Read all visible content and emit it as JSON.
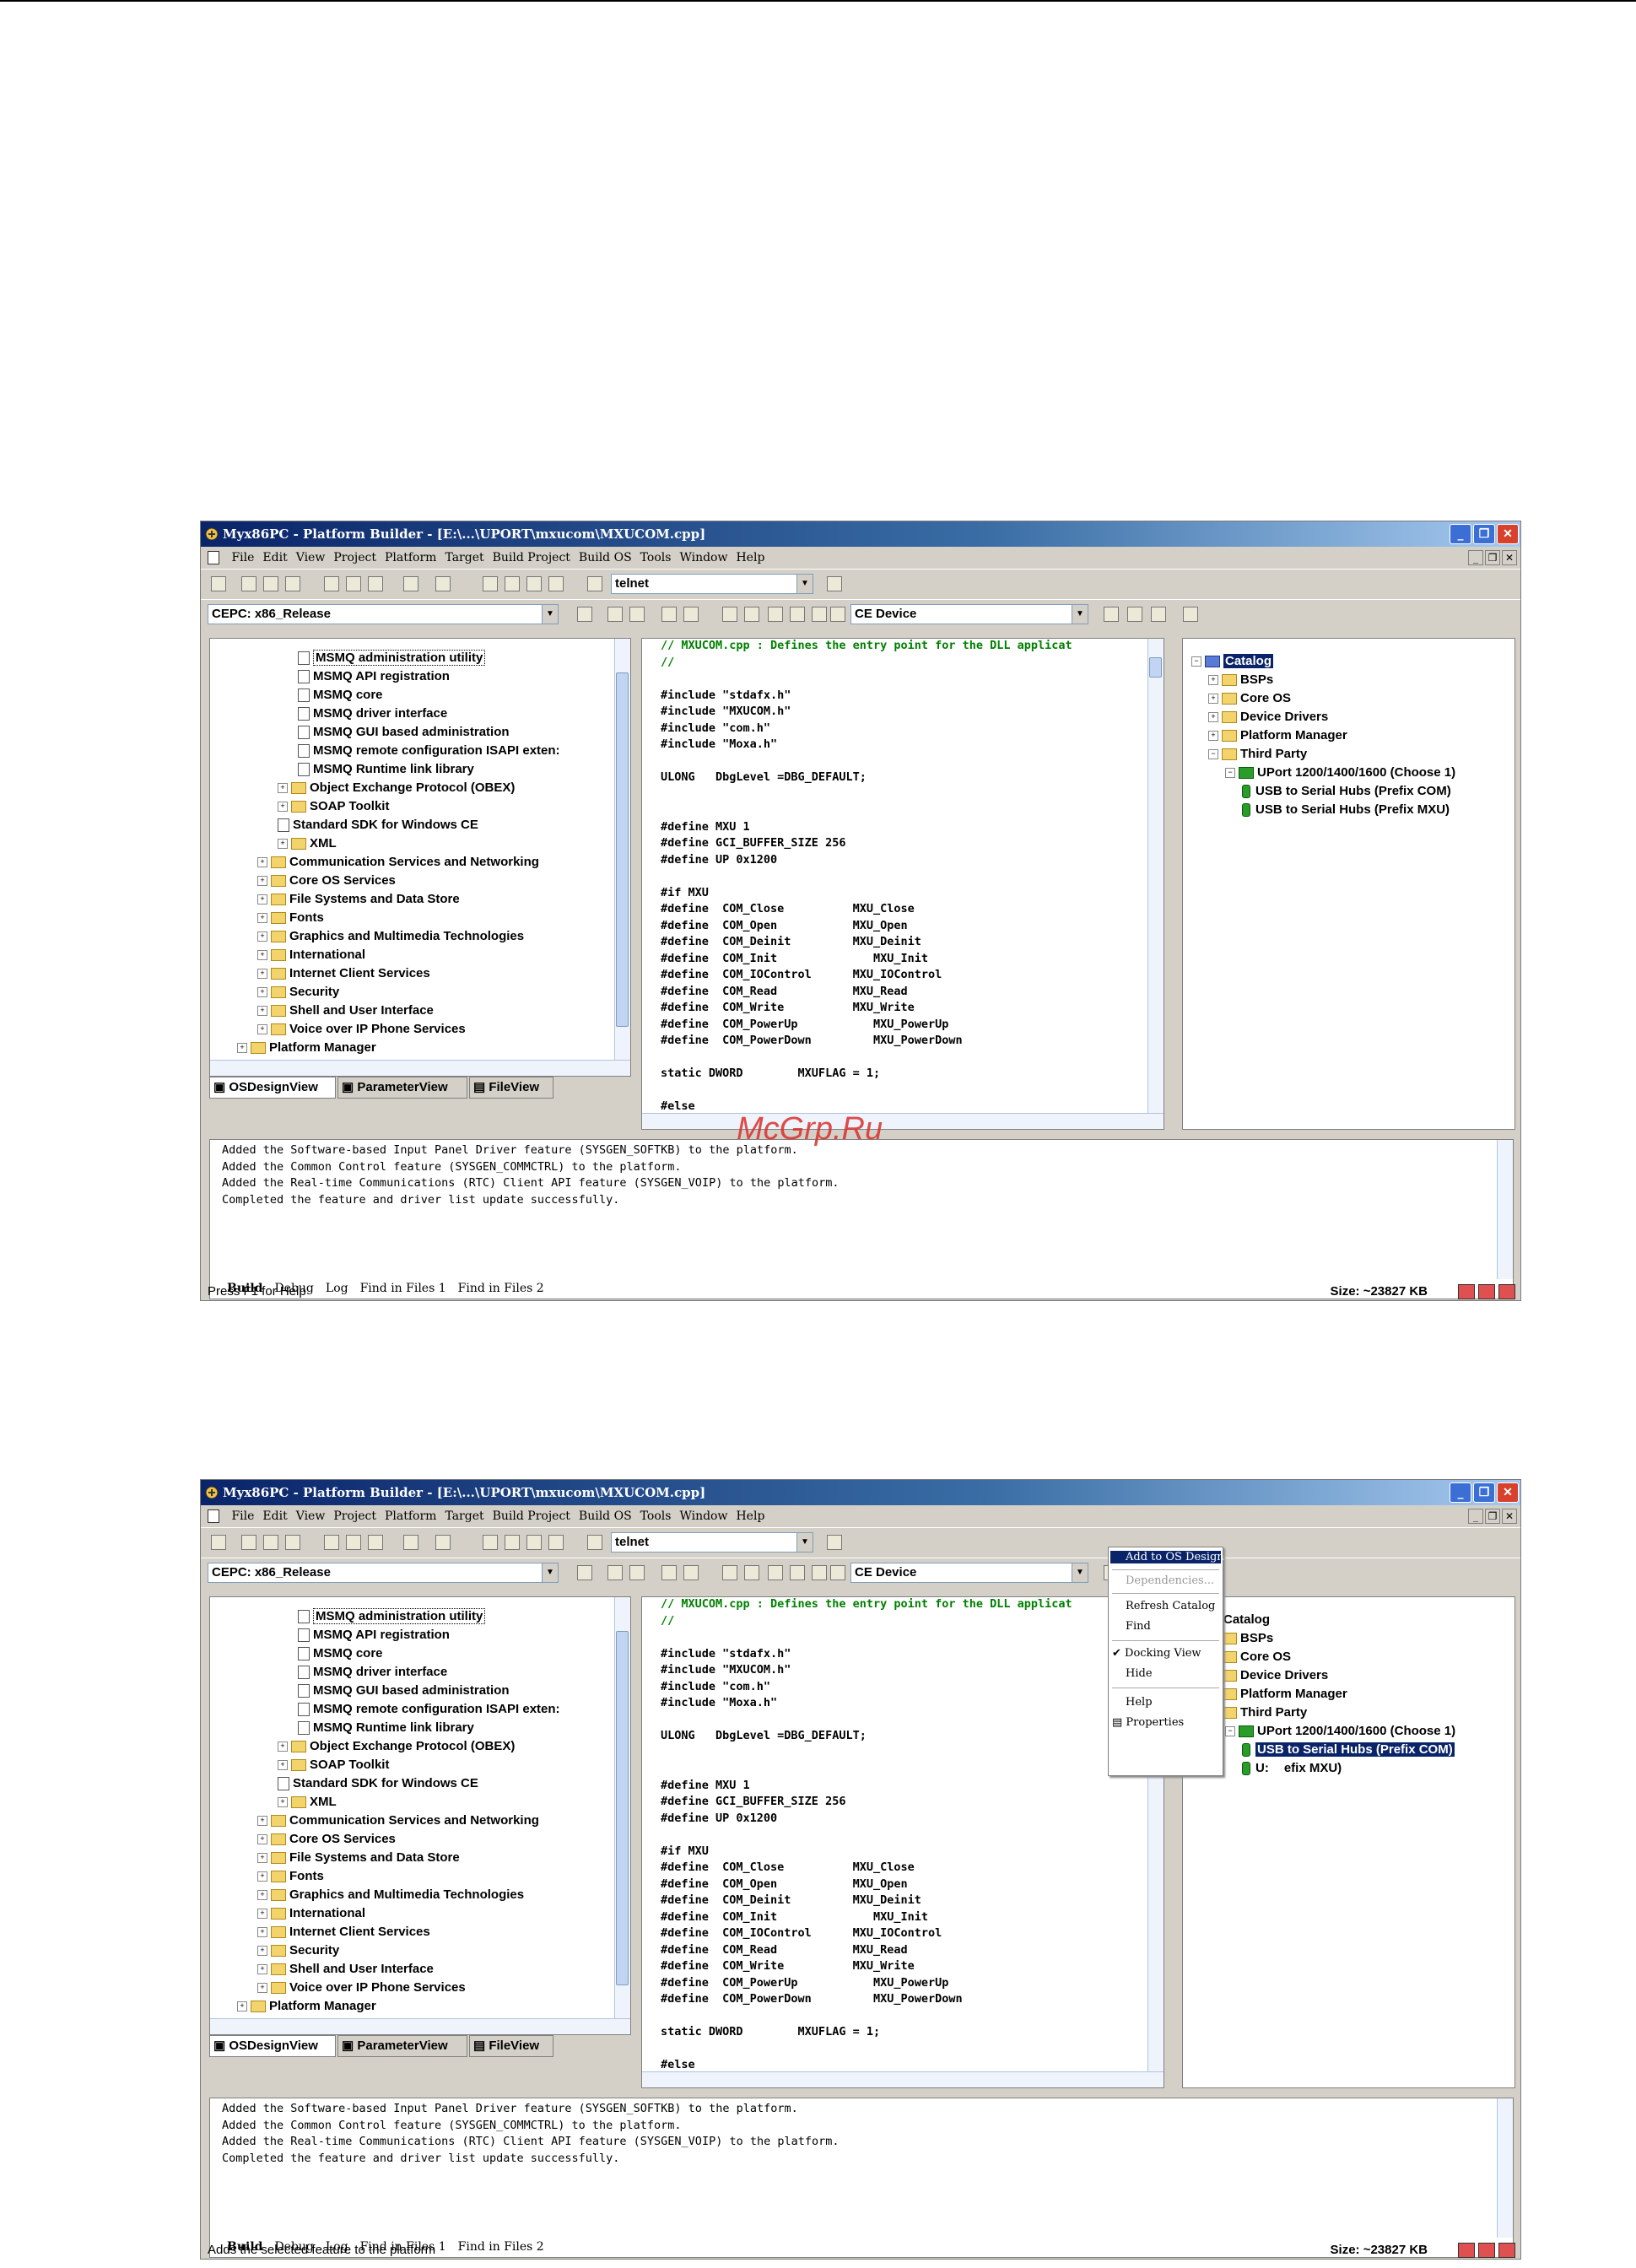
{
  "window_title": "Myx86PC - Platform Builder - [E:\\...\\UPORT\\mxucom\\MXUCOM.cpp]",
  "menu": [
    "File",
    "Edit",
    "View",
    "Project",
    "Platform",
    "Target",
    "Build Project",
    "Build OS",
    "Tools",
    "Window",
    "Help"
  ],
  "toolbar": {
    "find_combo": "telnet",
    "config_combo": "CEPC: x86_Release",
    "device_combo": "CE Device"
  },
  "left_tree": [
    {
      "label": "MSMQ administration utility",
      "type": "file",
      "indent": 4
    },
    {
      "label": "MSMQ API registration",
      "type": "file",
      "indent": 4
    },
    {
      "label": "MSMQ core",
      "type": "file",
      "indent": 4
    },
    {
      "label": "MSMQ driver interface",
      "type": "file",
      "indent": 4
    },
    {
      "label": "MSMQ GUI based administration",
      "type": "file",
      "indent": 4
    },
    {
      "label": "MSMQ remote configuration ISAPI exten:",
      "type": "file",
      "indent": 4
    },
    {
      "label": "MSMQ Runtime link library",
      "type": "file",
      "indent": 4
    },
    {
      "label": "Object Exchange Protocol (OBEX)",
      "type": "folder",
      "indent": 3
    },
    {
      "label": "SOAP Toolkit",
      "type": "folder",
      "indent": 3
    },
    {
      "label": "Standard SDK for Windows CE",
      "type": "file",
      "indent": 3
    },
    {
      "label": "XML",
      "type": "folder",
      "indent": 3
    },
    {
      "label": "Communication Services and Networking",
      "type": "folder",
      "indent": 2
    },
    {
      "label": "Core OS Services",
      "type": "folder",
      "indent": 2
    },
    {
      "label": "File Systems and Data Store",
      "type": "folder",
      "indent": 2
    },
    {
      "label": "Fonts",
      "type": "folder",
      "indent": 2
    },
    {
      "label": "Graphics and Multimedia Technologies",
      "type": "folder",
      "indent": 2
    },
    {
      "label": "International",
      "type": "folder",
      "indent": 2
    },
    {
      "label": "Internet Client Services",
      "type": "folder",
      "indent": 2
    },
    {
      "label": "Security",
      "type": "folder",
      "indent": 2
    },
    {
      "label": "Shell and User Interface",
      "type": "folder",
      "indent": 2
    },
    {
      "label": "Voice over IP Phone Services",
      "type": "folder",
      "indent": 2
    },
    {
      "label": "Platform Manager",
      "type": "folder",
      "indent": 1
    }
  ],
  "left_tabs": [
    "OSDesignView",
    "ParameterView",
    "FileView"
  ],
  "code_lines": [
    {
      "t": "// MXUCOM.cpp : Defines the entry point for the DLL applicat",
      "c": "cm"
    },
    {
      "t": "//",
      "c": "cm"
    },
    {
      "t": "",
      "c": ""
    },
    {
      "t": "#include \"stdafx.h\"",
      "c": "pp"
    },
    {
      "t": "#include \"MXUCOM.h\"",
      "c": "pp"
    },
    {
      "t": "#include \"com.h\"",
      "c": "pp"
    },
    {
      "t": "#include \"Moxa.h\"",
      "c": "pp"
    },
    {
      "t": "",
      "c": ""
    },
    {
      "t": "ULONG   DbgLevel =DBG_DEFAULT;",
      "c": ""
    },
    {
      "t": "",
      "c": ""
    },
    {
      "t": "",
      "c": ""
    },
    {
      "t": "#define MXU 1",
      "c": "pp"
    },
    {
      "t": "#define GCI_BUFFER_SIZE 256",
      "c": "pp"
    },
    {
      "t": "#define UP 0x1200",
      "c": "pp"
    },
    {
      "t": "",
      "c": ""
    },
    {
      "t": "#if MXU",
      "c": "pp"
    },
    {
      "t": "#define  COM_Close          MXU_Close",
      "c": "pp"
    },
    {
      "t": "#define  COM_Open           MXU_Open",
      "c": "pp"
    },
    {
      "t": "#define  COM_Deinit         MXU_Deinit",
      "c": "pp"
    },
    {
      "t": "#define  COM_Init              MXU_Init",
      "c": "pp"
    },
    {
      "t": "#define  COM_IOControl      MXU_IOControl",
      "c": "pp"
    },
    {
      "t": "#define  COM_Read           MXU_Read",
      "c": "pp"
    },
    {
      "t": "#define  COM_Write          MXU_Write",
      "c": "pp"
    },
    {
      "t": "#define  COM_PowerUp           MXU_PowerUp",
      "c": "pp"
    },
    {
      "t": "#define  COM_PowerDown         MXU_PowerDown",
      "c": "pp"
    },
    {
      "t": "",
      "c": ""
    },
    {
      "t": "static DWORD        MXUFLAG = 1;",
      "c": "kw"
    },
    {
      "t": "",
      "c": ""
    },
    {
      "t": "#else",
      "c": "pp"
    }
  ],
  "catalog_tree": [
    {
      "label": "Catalog",
      "type": "root",
      "indent": 0
    },
    {
      "label": "BSPs",
      "type": "folder",
      "indent": 1
    },
    {
      "label": "Core OS",
      "type": "folder",
      "indent": 1
    },
    {
      "label": "Device Drivers",
      "type": "folder",
      "indent": 1
    },
    {
      "label": "Platform Manager",
      "type": "folder",
      "indent": 1
    },
    {
      "label": "Third Party",
      "type": "folder",
      "indent": 1
    },
    {
      "label": "UPort 1200/1400/1600 (Choose 1)",
      "type": "group",
      "indent": 2
    },
    {
      "label": "USB to Serial Hubs (Prefix COM)",
      "type": "leaf",
      "indent": 3
    },
    {
      "label": "USB to Serial Hubs (Prefix MXU)",
      "type": "leaf",
      "indent": 3
    }
  ],
  "catalog_tree_2_last": "U:",
  "catalog_tree_2_last_tail": "efix MXU)",
  "output_lines": [
    "Added the Software-based Input Panel Driver feature (SYSGEN_SOFTKB) to the platform.",
    "Added the Common Control feature (SYSGEN_COMMCTRL) to the platform.",
    "Added the Real-time Communications (RTC) Client API feature (SYSGEN_VOIP) to the platform.",
    "Completed the feature and driver list update successfully."
  ],
  "output_tabs": [
    "Build",
    "Debug",
    "Log",
    "Find in Files 1",
    "Find in Files 2"
  ],
  "status": {
    "shot1_text": "Press F1 for Help",
    "shot2_text": "Adds the selected feature to the platform",
    "size": "Size: ~23827 KB"
  },
  "context_menu": [
    "Add to OS Design",
    "Dependencies...",
    "Refresh Catalog",
    "Find",
    "Docking View",
    "Hide",
    "Help",
    "Properties"
  ],
  "watermark": "McGrp.Ru"
}
